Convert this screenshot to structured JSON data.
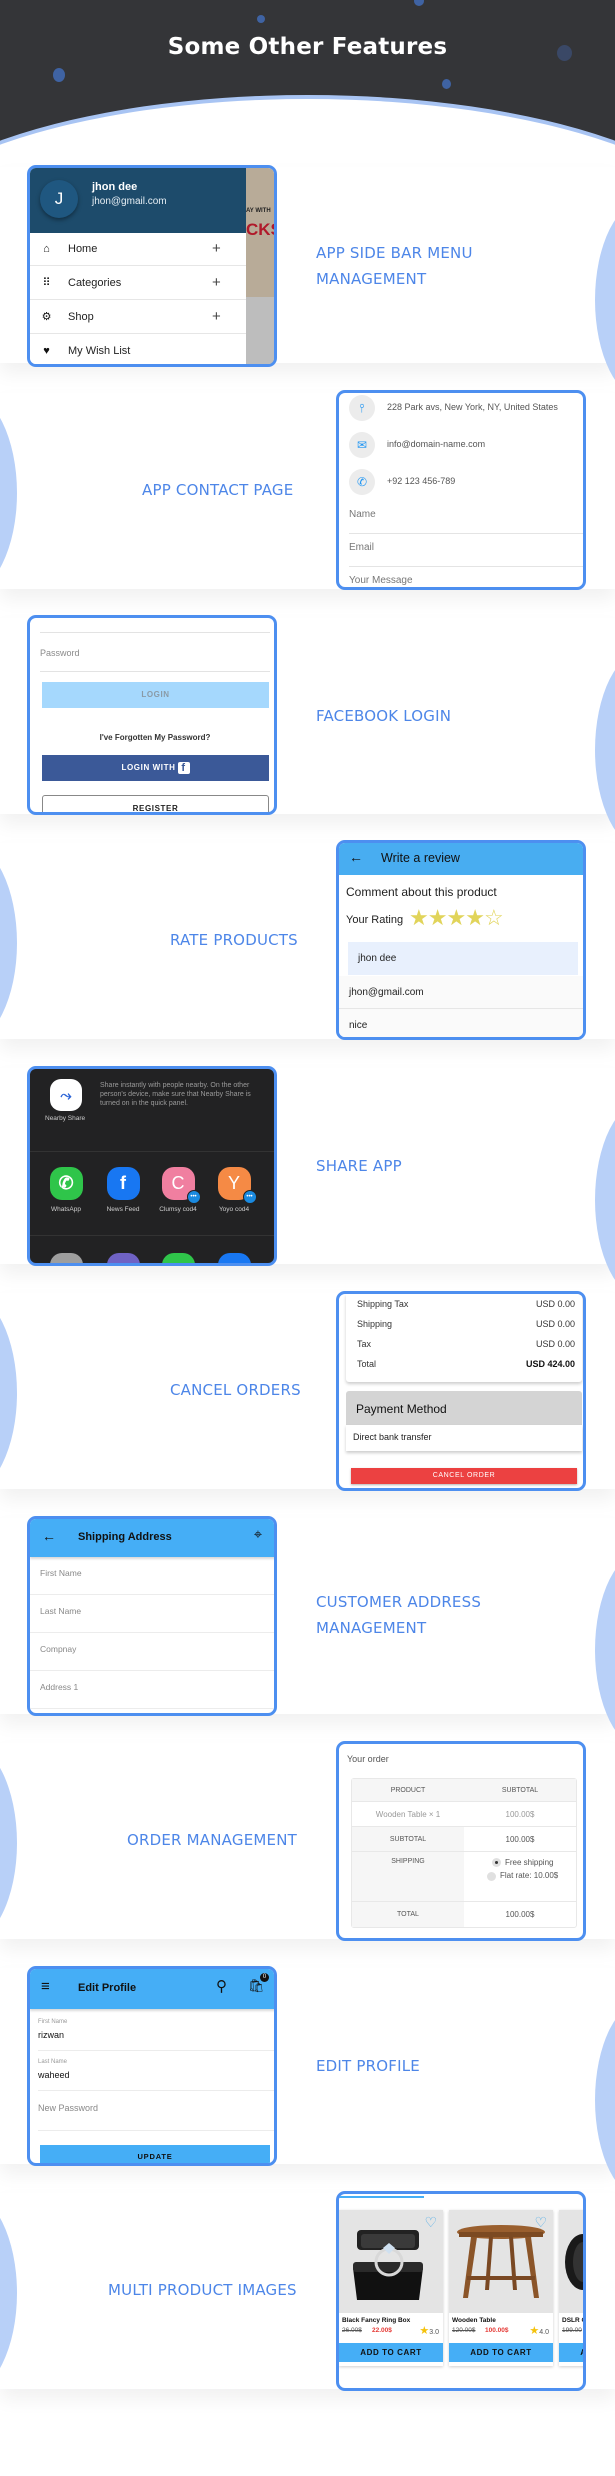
{
  "page": {
    "title": "Some Other Features",
    "colors": {
      "accent": "#4d86e8",
      "dark": "#343538",
      "frame": "#4d8ff0",
      "appbar": "#45aef6",
      "danger": "#ec4141"
    }
  },
  "features": [
    {
      "label_lines": [
        "APP SIDE BAR MENU",
        "MANAGEMENT"
      ]
    },
    {
      "label_lines": [
        "APP CONTACT PAGE"
      ]
    },
    {
      "label_lines": [
        "FACEBOOK LOGIN"
      ]
    },
    {
      "label_lines": [
        "RATE PRODUCTS"
      ]
    },
    {
      "label_lines": [
        "SHARE APP"
      ]
    },
    {
      "label_lines": [
        "CANCEL ORDERS"
      ]
    },
    {
      "label_lines": [
        "CUSTOMER ADDRESS",
        "MANAGEMENT"
      ]
    },
    {
      "label_lines": [
        "ORDER MANAGEMENT"
      ]
    },
    {
      "label_lines": [
        "EDIT PROFILE"
      ]
    },
    {
      "label_lines": [
        "MULTI PRODUCT IMAGES"
      ]
    }
  ],
  "sidebar": {
    "avatar_letter": "J",
    "user_name": "jhon dee",
    "user_email": "jhon@gmail.com",
    "background_ad_line1": "AY WITH",
    "background_ad_line2": "CKS",
    "items": [
      {
        "label": "Home",
        "icon": "home-icon",
        "expand": "+"
      },
      {
        "label": "Categories",
        "icon": "grid-icon",
        "expand": "+"
      },
      {
        "label": "Shop",
        "icon": "shop-icon",
        "expand": "+"
      },
      {
        "label": "My Wish List",
        "icon": "heart-icon",
        "expand": ""
      }
    ]
  },
  "contact": {
    "address": "228 Park avs, New York, NY, United States",
    "email": "info@domain-name.com",
    "phone": "+92 123 456-789",
    "fields": [
      "Name",
      "Email",
      "Your Message"
    ]
  },
  "login": {
    "password_placeholder": "Password",
    "login_button": "LOGIN",
    "forgot_link": "I've Forgotten My Password?",
    "facebook_button": "LOGIN WITH",
    "facebook_glyph": "f",
    "register_button": "REGISTER"
  },
  "review": {
    "title": "Write a review",
    "comment_heading": "Comment about this product",
    "rating_label": "Your Rating",
    "rating": 4,
    "rating_max": 5,
    "name_value": "jhon dee",
    "email_value": "jhon@gmail.com",
    "comment_value": "nice"
  },
  "share": {
    "nearby_label": "Nearby Share",
    "nearby_description": "Share instantly with people nearby. On the other person's device, make sure that Nearby Share is turned on in the quick panel.",
    "apps": [
      {
        "label": "WhatsApp",
        "glyph": "✆",
        "color": "#2fc54a",
        "badge": false
      },
      {
        "label": "News Feed",
        "glyph": "f",
        "color": "#1877f2",
        "badge": false
      },
      {
        "label": "Clumsy cod4",
        "glyph": "C",
        "color": "#f07fa0",
        "badge": true
      },
      {
        "label": "Yoyo cod4",
        "glyph": "Y",
        "color": "#f58a45",
        "badge": true
      }
    ]
  },
  "cancel_order": {
    "rows": [
      {
        "label": "Shipping Tax",
        "value": "USD 0.00"
      },
      {
        "label": "Shipping",
        "value": "USD 0.00"
      },
      {
        "label": "Tax",
        "value": "USD 0.00"
      },
      {
        "label": "Total",
        "value": "USD 424.00"
      }
    ],
    "payment_heading": "Payment Method",
    "payment_value": "Direct bank transfer",
    "cancel_button": "CANCEL ORDER"
  },
  "address": {
    "title": "Shipping Address",
    "fields": [
      "First Name",
      "Last Name",
      "Compnay",
      "Address 1"
    ]
  },
  "order": {
    "title": "Your order",
    "headers": [
      "PRODUCT",
      "SUBTOTAL"
    ],
    "item": "Wooden Table",
    "item_qty": "× 1",
    "item_price": "100.00$",
    "subtotal_label": "SUBTOTAL",
    "subtotal_value": "100.00$",
    "shipping_label": "SHIPPING",
    "shipping_options": [
      "Free shipping",
      "Flat rate: 10.00$"
    ],
    "shipping_selected": 0,
    "total_label": "TOTAL",
    "total_value": "100.00$"
  },
  "edit_profile": {
    "title": "Edit Profile",
    "cart_count": "0",
    "first_name_label": "First Name",
    "first_name_value": "rizwan",
    "last_name_label": "Last Name",
    "last_name_value": "waheed",
    "password_placeholder": "New Password",
    "update_button": "UPDATE"
  },
  "products": {
    "items": [
      {
        "name": "Black Fancy Ring Box",
        "old_price": "26.00$",
        "price": "22.00$",
        "rating": "3.0"
      },
      {
        "name": "Wooden Table",
        "old_price": "120.00$",
        "price": "100.00$",
        "rating": "4.0"
      },
      {
        "name": "DSLR C",
        "old_price": "199.00",
        "price": "",
        "rating": ""
      }
    ],
    "add_to_cart": "ADD TO CART"
  }
}
